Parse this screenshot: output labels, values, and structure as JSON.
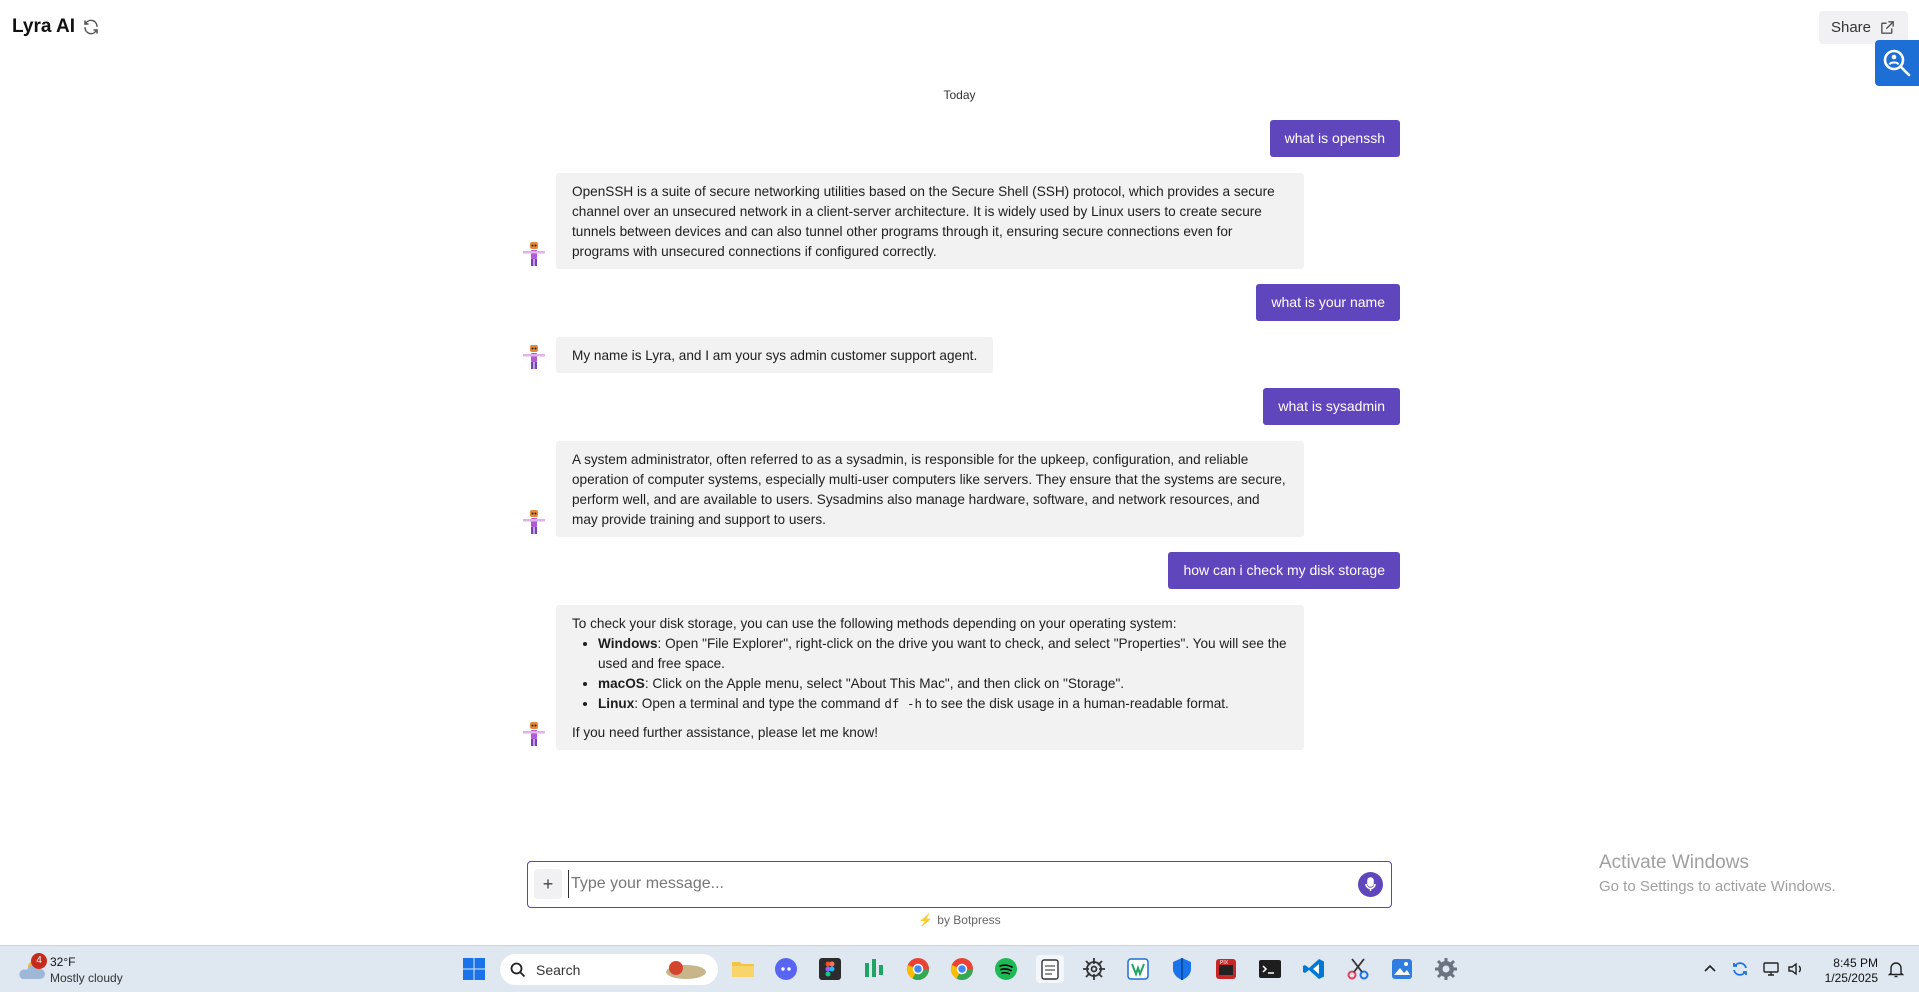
{
  "header": {
    "title": "Lyra AI",
    "share_label": "Share"
  },
  "chat": {
    "day_label": "Today",
    "messages": [
      {
        "role": "user",
        "text": "what is openssh"
      },
      {
        "role": "bot",
        "text": "OpenSSH is a suite of secure networking utilities based on the Secure Shell (SSH) protocol, which provides a secure channel over an unsecured network in a client-server architecture. It is widely used by Linux users to create secure tunnels between devices and can also tunnel other programs through it, ensuring secure connections even for programs with unsecured connections if configured correctly."
      },
      {
        "role": "user",
        "text": "what is your name"
      },
      {
        "role": "bot",
        "text": "My name is Lyra, and I am your sys admin customer support agent."
      },
      {
        "role": "user",
        "text": "what is sysadmin"
      },
      {
        "role": "bot",
        "text": "A system administrator, often referred to as a sysadmin, is responsible for the upkeep, configuration, and reliable operation of computer systems, especially multi-user computers like servers. They ensure that the systems are secure, perform well, and are available to users. Sysadmins also manage hardware, software, and network resources, and may provide training and support to users."
      },
      {
        "role": "user",
        "text": "how can i check my disk storage"
      },
      {
        "role": "bot",
        "intro": "To check your disk storage, you can use the following methods depending on your operating system:",
        "items": [
          {
            "label": "Windows",
            "text": ": Open \"File Explorer\", right-click on the drive you want to check, and select \"Properties\". You will see the used and free space."
          },
          {
            "label": "macOS",
            "text": ": Click on the Apple menu, select \"About This Mac\", and then click on \"Storage\"."
          },
          {
            "label": "Linux",
            "text": ": Open a terminal and type the command ",
            "code": "df -h",
            "text2": " to see the disk usage in a human-readable format."
          }
        ],
        "outro": "If you need further assistance, please let me know!"
      }
    ]
  },
  "composer": {
    "plus_label": "+",
    "placeholder": "Type your message...",
    "powered_by": "by Botpress"
  },
  "watermark": {
    "line1": "Activate Windows",
    "line2": "Go to Settings to activate Windows."
  },
  "taskbar": {
    "weather_badge": "4",
    "weather_temp": "32°F",
    "weather_condition": "Mostly cloudy",
    "search_label": "Search",
    "time": "8:45 PM",
    "date": "1/25/2025"
  },
  "colors": {
    "accent": "#6046bd",
    "bubble_bot": "#f2f2f3",
    "taskbar": "#dfe8f1"
  }
}
